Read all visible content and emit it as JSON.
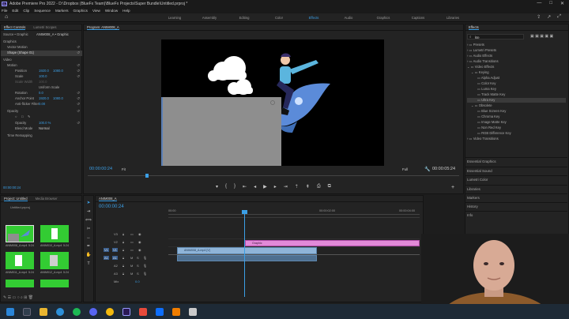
{
  "titlebar": {
    "text": "Adobe Premiere Pro 2022 - D:\\Dropbox (BlueFx Team)\\BlueFx Projects\\Super Bundle\\Untitled.prproj *",
    "controls": [
      "—",
      "□",
      "✕"
    ]
  },
  "menu": [
    "File",
    "Edit",
    "Clip",
    "Sequence",
    "Markers",
    "Graphics",
    "View",
    "Window",
    "Help"
  ],
  "workspaces": {
    "tabs": [
      "Learning",
      "Assembly",
      "Editing",
      "Color",
      "Effects",
      "Audio",
      "Graphics",
      "Captions",
      "Libraries"
    ],
    "active": "Effects"
  },
  "effect_controls": {
    "tabs": [
      "Effect Controls",
      "Lumetri Scopes"
    ],
    "source": "Source • Graphic",
    "sequence": "ANIM008_A • Graphic",
    "rows": [
      {
        "label": "Graphics"
      },
      {
        "label": "Vector Motion"
      },
      {
        "label": "Shape (Shape 01)"
      },
      {
        "label": "Video"
      },
      {
        "label": "Motion"
      },
      {
        "label": "Position",
        "v1": "1920.0",
        "v2": "1080.0"
      },
      {
        "label": "Scale",
        "v1": "100.0"
      },
      {
        "label": "Scale Width",
        "v1": "100.0"
      },
      {
        "label": "Uniform Scale"
      },
      {
        "label": "Rotation",
        "v1": "0.0"
      },
      {
        "label": "Anchor Point",
        "v1": "1920.0",
        "v2": "1080.0"
      },
      {
        "label": "Anti-flicker Filter",
        "v1": "0.00"
      },
      {
        "label": "Opacity"
      },
      {
        "label": "Opacity",
        "v1": "100.0 %"
      },
      {
        "label": "Blend Mode",
        "v1": "Normal"
      },
      {
        "label": "Time Remapping"
      }
    ],
    "timecode": "00:00:00:24"
  },
  "program": {
    "title": "Program: ANIM008_A",
    "timecode_left": "00:00:00:24",
    "fit": "Fit",
    "full": "Full",
    "timecode_right": "00:00:05:24"
  },
  "project": {
    "tabs": [
      "Project: Untitled",
      "Media Browser"
    ],
    "file": "Untitled.prproj",
    "items": [
      {
        "label": "ANIM008_A.mp4",
        "dur": "5:24"
      },
      {
        "label": "ANIM010_A.mp4",
        "dur": "5:24"
      },
      {
        "label": "ANIM011_A.mp4",
        "dur": "5:24"
      },
      {
        "label": "ANIM012_A.mp4",
        "dur": "5:24"
      }
    ]
  },
  "timeline": {
    "tab": "ANIM008_A",
    "timecode": "00:00:00:24",
    "ruler": [
      "00:00",
      "00:00:02:00",
      "00:00:04:00"
    ],
    "tracks": [
      "V3",
      "V2",
      "V1",
      "A1",
      "A2",
      "A3",
      "Mix"
    ],
    "mix_value": "0.0",
    "clips": {
      "v2": "Graphic",
      "v1": "ANIM008_A.mp4 [V]"
    }
  },
  "effects": {
    "title": "Effects",
    "search": "kte",
    "tree": [
      {
        "label": "Presets",
        "indent": 0
      },
      {
        "label": "Lumetri Presets",
        "indent": 0
      },
      {
        "label": "Audio Effects",
        "indent": 0
      },
      {
        "label": "Audio Transitions",
        "indent": 0
      },
      {
        "label": "Video Effects",
        "indent": 0
      },
      {
        "label": "Keying",
        "indent": 1
      },
      {
        "label": "Alpha Adjust",
        "indent": 2
      },
      {
        "label": "Color Key",
        "indent": 2
      },
      {
        "label": "Luma Key",
        "indent": 2
      },
      {
        "label": "Track Matte Key",
        "indent": 2
      },
      {
        "label": "Ultra Key",
        "indent": 2,
        "highlight": true
      },
      {
        "label": "Obsolete",
        "indent": 1
      },
      {
        "label": "Blue Screen Key",
        "indent": 2
      },
      {
        "label": "Chroma Key",
        "indent": 2
      },
      {
        "label": "Image Matte Key",
        "indent": 2
      },
      {
        "label": "Non Red Key",
        "indent": 2
      },
      {
        "label": "RGB Difference Key",
        "indent": 2
      },
      {
        "label": "Video Transitions",
        "indent": 0
      }
    ],
    "sections": [
      "Essential Graphics",
      "Essential Sound",
      "Lumetri Color",
      "Libraries",
      "Markers",
      "History",
      "Info"
    ]
  },
  "taskbar": {
    "icons": [
      "start-icon",
      "search-icon",
      "files-icon",
      "edge-icon",
      "spotify-icon",
      "discord-icon",
      "chrome-icon",
      "premiere-icon",
      "after-effects-icon",
      "dropbox-icon",
      "vlc-icon",
      "paint-icon"
    ]
  }
}
